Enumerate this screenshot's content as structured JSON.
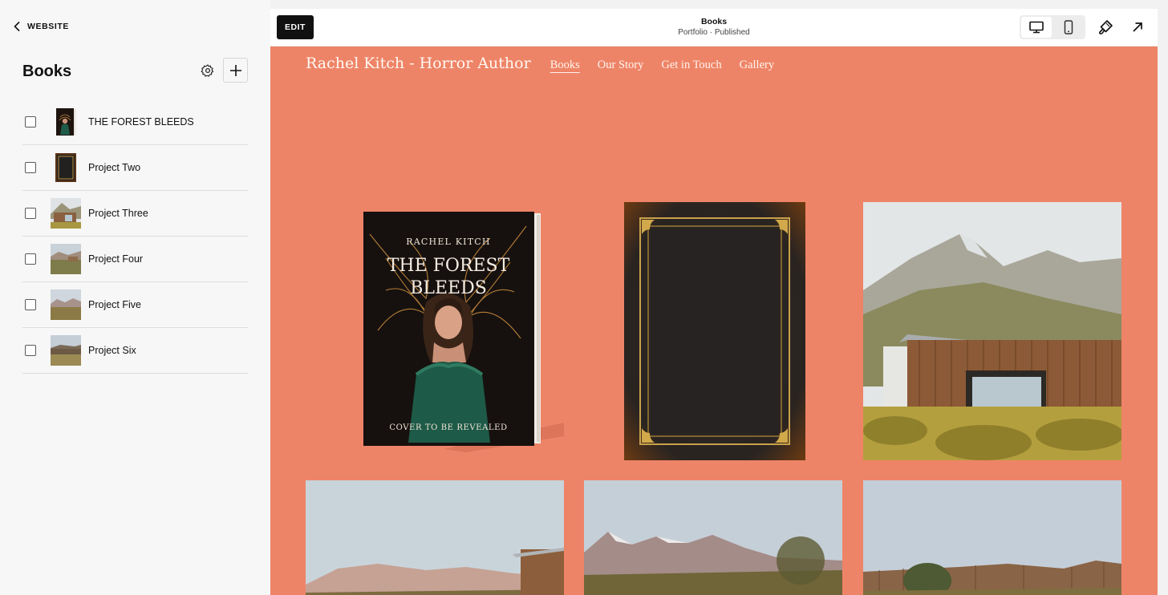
{
  "panel": {
    "back_label": "WEBSITE",
    "title": "Books",
    "items": [
      {
        "label": "THE FOREST BLEEDS",
        "thumb": "book-cover"
      },
      {
        "label": "Project Two",
        "thumb": "leather-book"
      },
      {
        "label": "Project Three",
        "thumb": "cabin-photo"
      },
      {
        "label": "Project Four",
        "thumb": "landscape-photo"
      },
      {
        "label": "Project Five",
        "thumb": "landscape-photo"
      },
      {
        "label": "Project Six",
        "thumb": "landscape-photo"
      }
    ]
  },
  "topbar": {
    "edit_label": "EDIT",
    "page_title": "Books",
    "page_status": "Portfolio · Published"
  },
  "site": {
    "title": "Rachel Kitch - Horror Author",
    "nav": [
      "Books",
      "Our Story",
      "Get in Touch",
      "Gallery"
    ],
    "active_nav": "Books",
    "background_color": "#ee8467"
  },
  "book": {
    "author": "RACHEL KITCH",
    "title_line1": "THE FOREST",
    "title_line2": "BLEEDS",
    "tagline": "COVER TO BE REVEALED"
  },
  "icons": {
    "back": "chevron-left-icon",
    "settings": "gear-icon",
    "add": "plus-icon",
    "desktop": "desktop-icon",
    "mobile": "mobile-icon",
    "style": "paintbrush-icon",
    "open": "arrow-up-right-icon"
  }
}
